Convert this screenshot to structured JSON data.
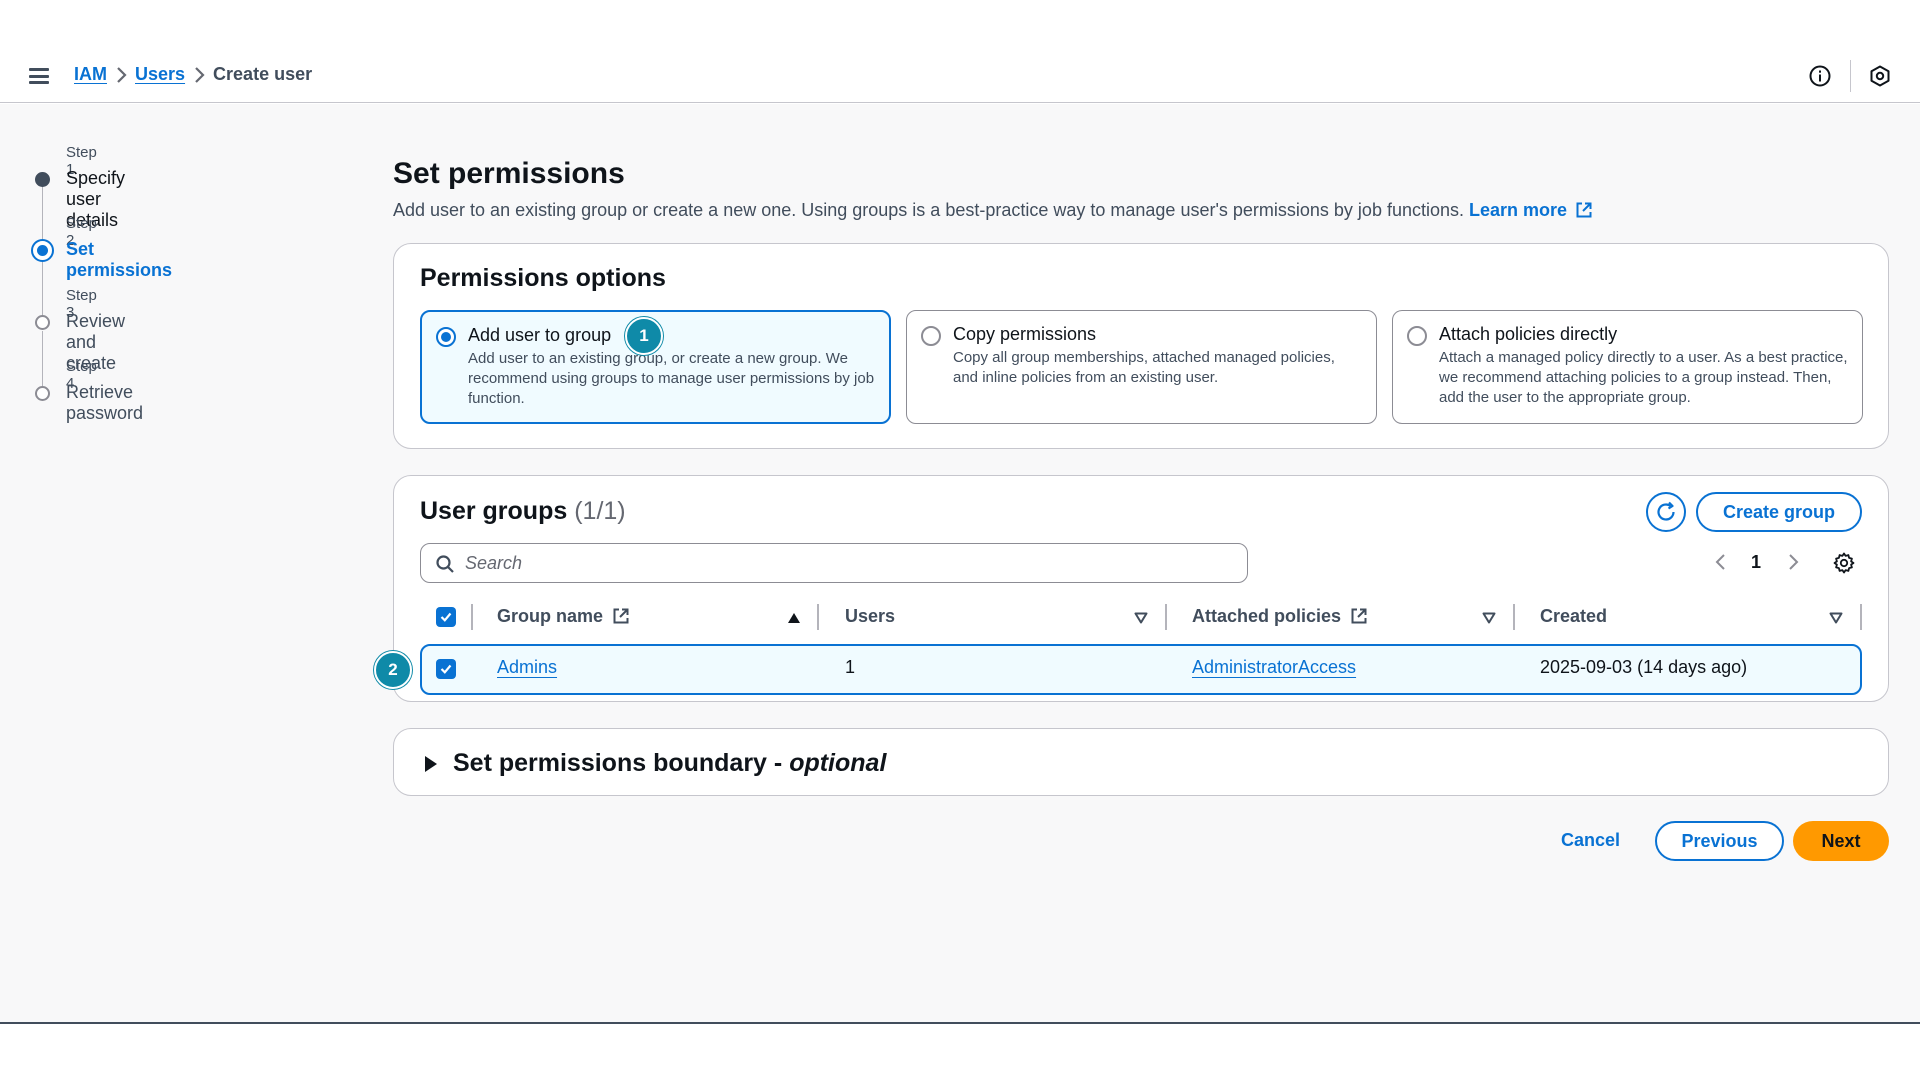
{
  "breadcrumb": {
    "items": [
      "IAM",
      "Users"
    ],
    "current": "Create user"
  },
  "steps": [
    {
      "number": "Step 1",
      "title": "Specify user details",
      "state": "done"
    },
    {
      "number": "Step 2",
      "title": "Set permissions",
      "state": "active"
    },
    {
      "number": "Step 3",
      "title": "Review and create",
      "state": "pending"
    },
    {
      "number": "Step 4",
      "title": "Retrieve password",
      "state": "pending"
    }
  ],
  "page": {
    "title": "Set permissions",
    "description": "Add user to an existing group or create a new one. Using groups is a best-practice way to manage user's permissions by job functions.",
    "learn_more": "Learn more"
  },
  "permissions_options": {
    "title": "Permissions options",
    "selected": "Add user to group",
    "options": [
      {
        "title": "Add user to group",
        "description": "Add user to an existing group, or create a new group. We recommend using groups to manage user permissions by job function."
      },
      {
        "title": "Copy permissions",
        "description": "Copy all group memberships, attached managed policies, and inline policies from an existing user."
      },
      {
        "title": "Attach policies directly",
        "description": "Attach a managed policy directly to a user. As a best practice, we recommend attaching policies to a group instead. Then, add the user to the appropriate group."
      }
    ]
  },
  "annotations": [
    "1",
    "2"
  ],
  "user_groups": {
    "title": "User groups",
    "count": "(1/1)",
    "create_group_label": "Create group",
    "search_placeholder": "Search",
    "search_value": "",
    "page": "1",
    "columns": [
      "Group name",
      "Users",
      "Attached policies",
      "Created"
    ],
    "rows": [
      {
        "group_name": "Admins",
        "users": "1",
        "attached_policies": "AdministratorAccess",
        "created": "2025-09-03 (14 days ago)",
        "selected": true
      }
    ]
  },
  "boundary": {
    "title": "Set permissions boundary - ",
    "title_emphasis": "optional"
  },
  "footer": {
    "cancel_label": "Cancel",
    "previous_label": "Previous",
    "next_label": "Next"
  },
  "colors": {
    "accent": "#0972d3",
    "primary_button": "#ff9900",
    "annotation_badge": "#0f8aa8"
  },
  "icons": [
    "menu-icon",
    "chevron-right-icon",
    "info-icon",
    "settings-hex-icon",
    "external-link-icon",
    "refresh-icon",
    "search-icon",
    "gear-icon",
    "chevron-left-icon",
    "sort-ascending-icon",
    "sort-descending-icon",
    "caret-right-icon",
    "checkmark-icon"
  ]
}
